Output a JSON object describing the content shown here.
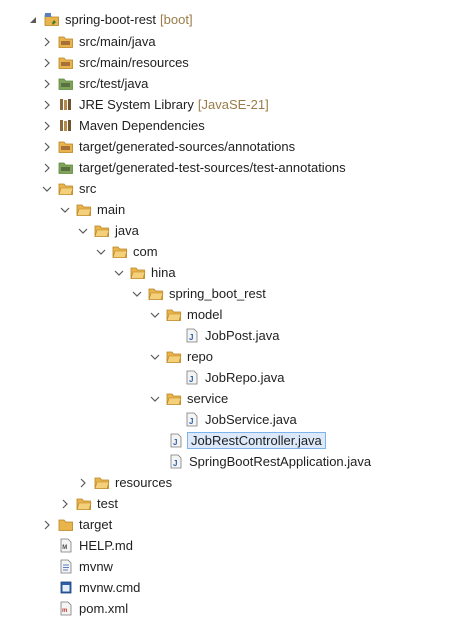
{
  "explorer": {
    "nodes": [
      {
        "label": "spring-boot-rest",
        "decoration": "[boot]",
        "icon": "project-icon",
        "twisty": "expanded-root"
      },
      {
        "label": "src/main/java",
        "icon": "source-folder-icon",
        "twisty": "collapsed"
      },
      {
        "label": "src/main/resources",
        "icon": "source-folder-icon",
        "twisty": "collapsed"
      },
      {
        "label": "src/test/java",
        "icon": "test-source-folder-icon",
        "twisty": "collapsed"
      },
      {
        "label": "JRE System Library",
        "decoration": "[JavaSE-21]",
        "icon": "library-icon",
        "twisty": "collapsed"
      },
      {
        "label": "Maven Dependencies",
        "icon": "library-icon",
        "twisty": "collapsed"
      },
      {
        "label": "target/generated-sources/annotations",
        "icon": "source-folder-icon",
        "twisty": "collapsed"
      },
      {
        "label": "target/generated-test-sources/test-annotations",
        "icon": "test-source-folder-icon",
        "twisty": "collapsed"
      },
      {
        "label": "src",
        "icon": "folder-icon",
        "twisty": "expanded"
      },
      {
        "label": "main",
        "icon": "folder-icon",
        "twisty": "expanded"
      },
      {
        "label": "java",
        "icon": "folder-icon",
        "twisty": "expanded"
      },
      {
        "label": "com",
        "icon": "folder-icon",
        "twisty": "expanded"
      },
      {
        "label": "hina",
        "icon": "folder-icon",
        "twisty": "expanded"
      },
      {
        "label": "spring_boot_rest",
        "icon": "folder-icon",
        "twisty": "expanded"
      },
      {
        "label": "model",
        "icon": "folder-icon",
        "twisty": "expanded"
      },
      {
        "label": "JobPost.java",
        "icon": "java-file-icon",
        "twisty": "none"
      },
      {
        "label": "repo",
        "icon": "folder-icon",
        "twisty": "expanded"
      },
      {
        "label": "JobRepo.java",
        "icon": "java-file-icon",
        "twisty": "none"
      },
      {
        "label": "service",
        "icon": "folder-icon",
        "twisty": "expanded"
      },
      {
        "label": "JobService.java",
        "icon": "java-file-icon",
        "twisty": "none"
      },
      {
        "label": "JobRestController.java",
        "icon": "java-file-icon",
        "twisty": "none",
        "selected": true
      },
      {
        "label": "SpringBootRestApplication.java",
        "icon": "java-file-icon",
        "twisty": "none"
      },
      {
        "label": "resources",
        "icon": "folder-icon",
        "twisty": "collapsed"
      },
      {
        "label": "test",
        "icon": "folder-icon",
        "twisty": "collapsed"
      },
      {
        "label": "target",
        "icon": "folder-icon",
        "twisty": "collapsed"
      },
      {
        "label": "HELP.md",
        "icon": "markdown-file-icon",
        "twisty": "none"
      },
      {
        "label": "mvnw",
        "icon": "text-file-icon",
        "twisty": "none"
      },
      {
        "label": "mvnw.cmd",
        "icon": "cmd-file-icon",
        "twisty": "none"
      },
      {
        "label": "pom.xml",
        "icon": "xml-file-icon",
        "twisty": "none"
      }
    ]
  },
  "colors": {
    "folder": "#e9b44c",
    "folder_dark": "#b98320",
    "source_brown": "#a7703a",
    "test_green": "#5b8c3a",
    "selection_bg": "#dbe9fb",
    "selection_border": "#7eb4ea",
    "decoration": "#9a7c4a"
  }
}
